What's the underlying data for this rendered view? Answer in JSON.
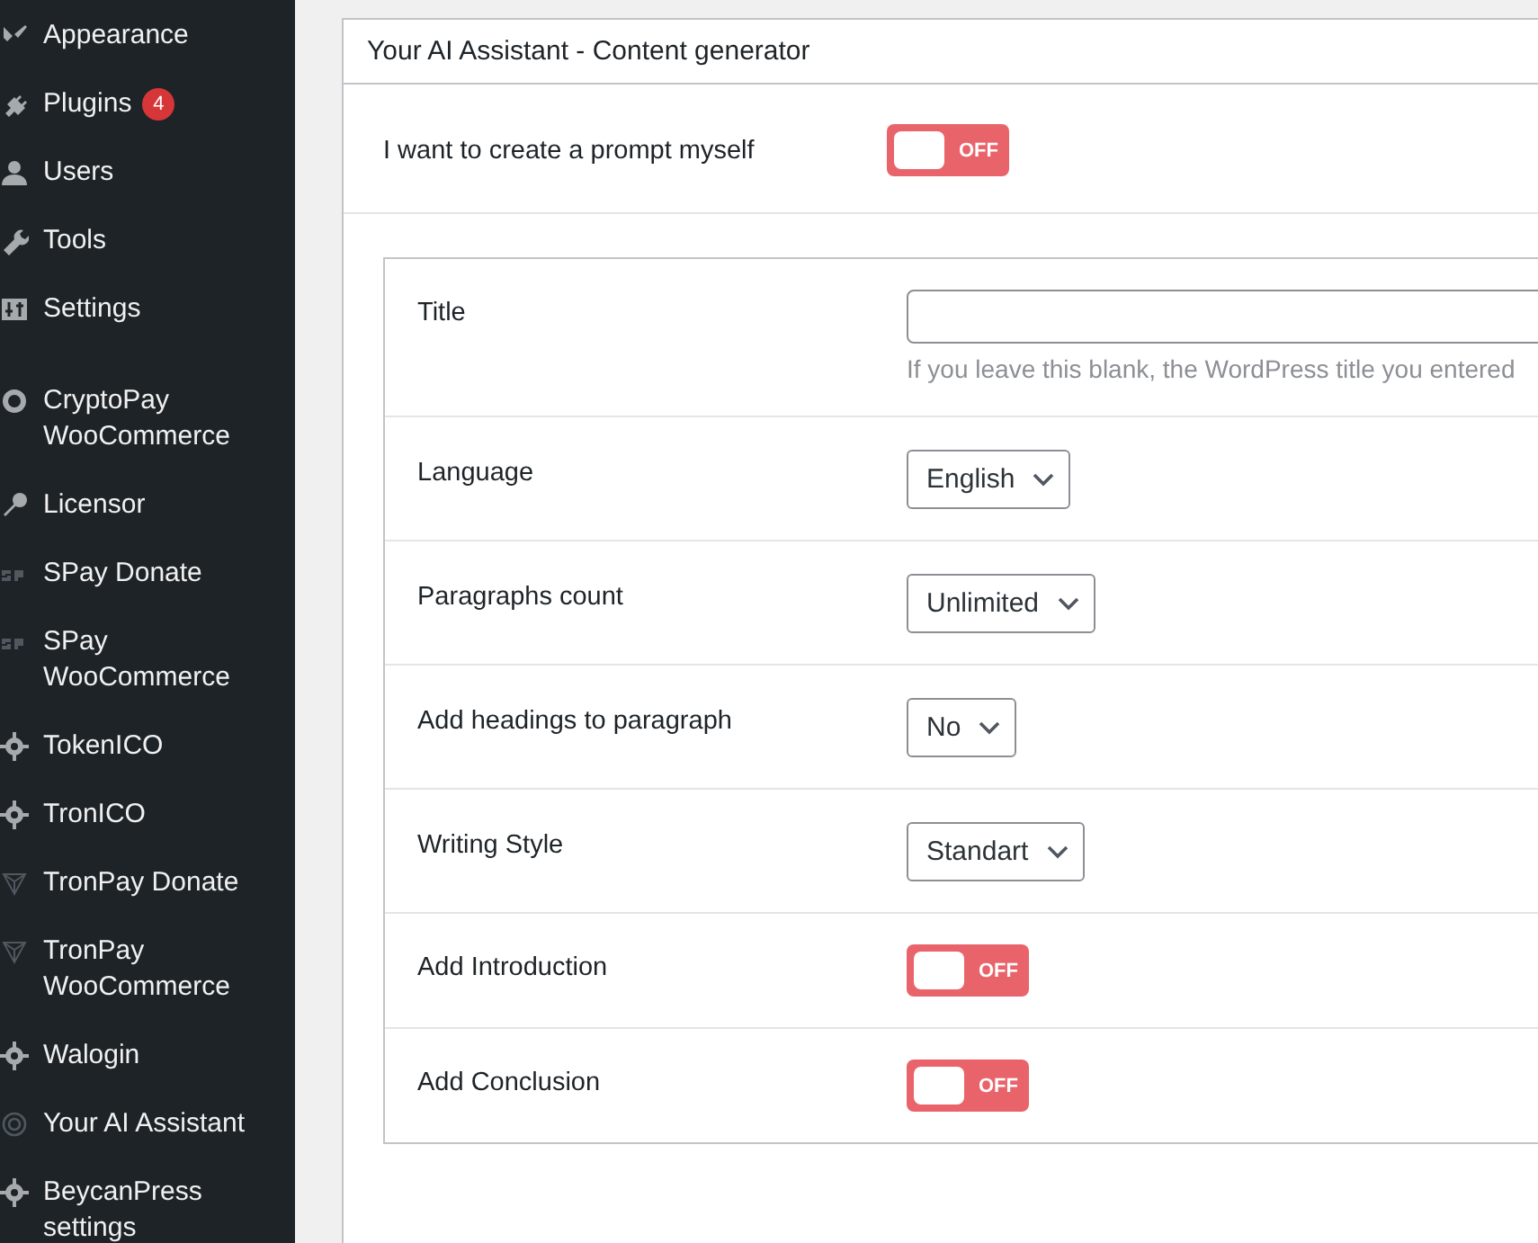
{
  "sidebar": {
    "items": [
      {
        "label": "Appearance"
      },
      {
        "label": "Plugins",
        "badge": "4"
      },
      {
        "label": "Users"
      },
      {
        "label": "Tools"
      },
      {
        "label": "Settings"
      },
      {
        "label": "CryptoPay WooCommerce"
      },
      {
        "label": "Licensor"
      },
      {
        "label": "SPay Donate"
      },
      {
        "label": "SPay WooCommerce"
      },
      {
        "label": "TokenICO"
      },
      {
        "label": "TronICO"
      },
      {
        "label": "TronPay Donate"
      },
      {
        "label": "TronPay WooCommerce"
      },
      {
        "label": "Walogin"
      },
      {
        "label": "Your AI Assistant"
      },
      {
        "label": "BeycanPress settings"
      }
    ]
  },
  "panel": {
    "title": "Your AI Assistant - Content generator",
    "prompt_toggle": {
      "label": "I want to create a prompt myself",
      "on": false,
      "state_text": "OFF"
    },
    "fields": [
      {
        "kind": "text",
        "label": "Title",
        "help": "If you leave this blank, the WordPress title you entered"
      },
      {
        "kind": "select",
        "label": "Language",
        "value": "English"
      },
      {
        "kind": "select",
        "label": "Paragraphs count",
        "value": "Unlimited"
      },
      {
        "kind": "select",
        "label": "Add headings to paragraph",
        "value": "No"
      },
      {
        "kind": "select",
        "label": "Writing Style",
        "value": "Standart"
      },
      {
        "kind": "toggle",
        "label": "Add Introduction",
        "on": false,
        "state_text": "OFF"
      },
      {
        "kind": "toggle",
        "label": "Add Conclusion",
        "on": false,
        "state_text": "OFF"
      }
    ]
  }
}
